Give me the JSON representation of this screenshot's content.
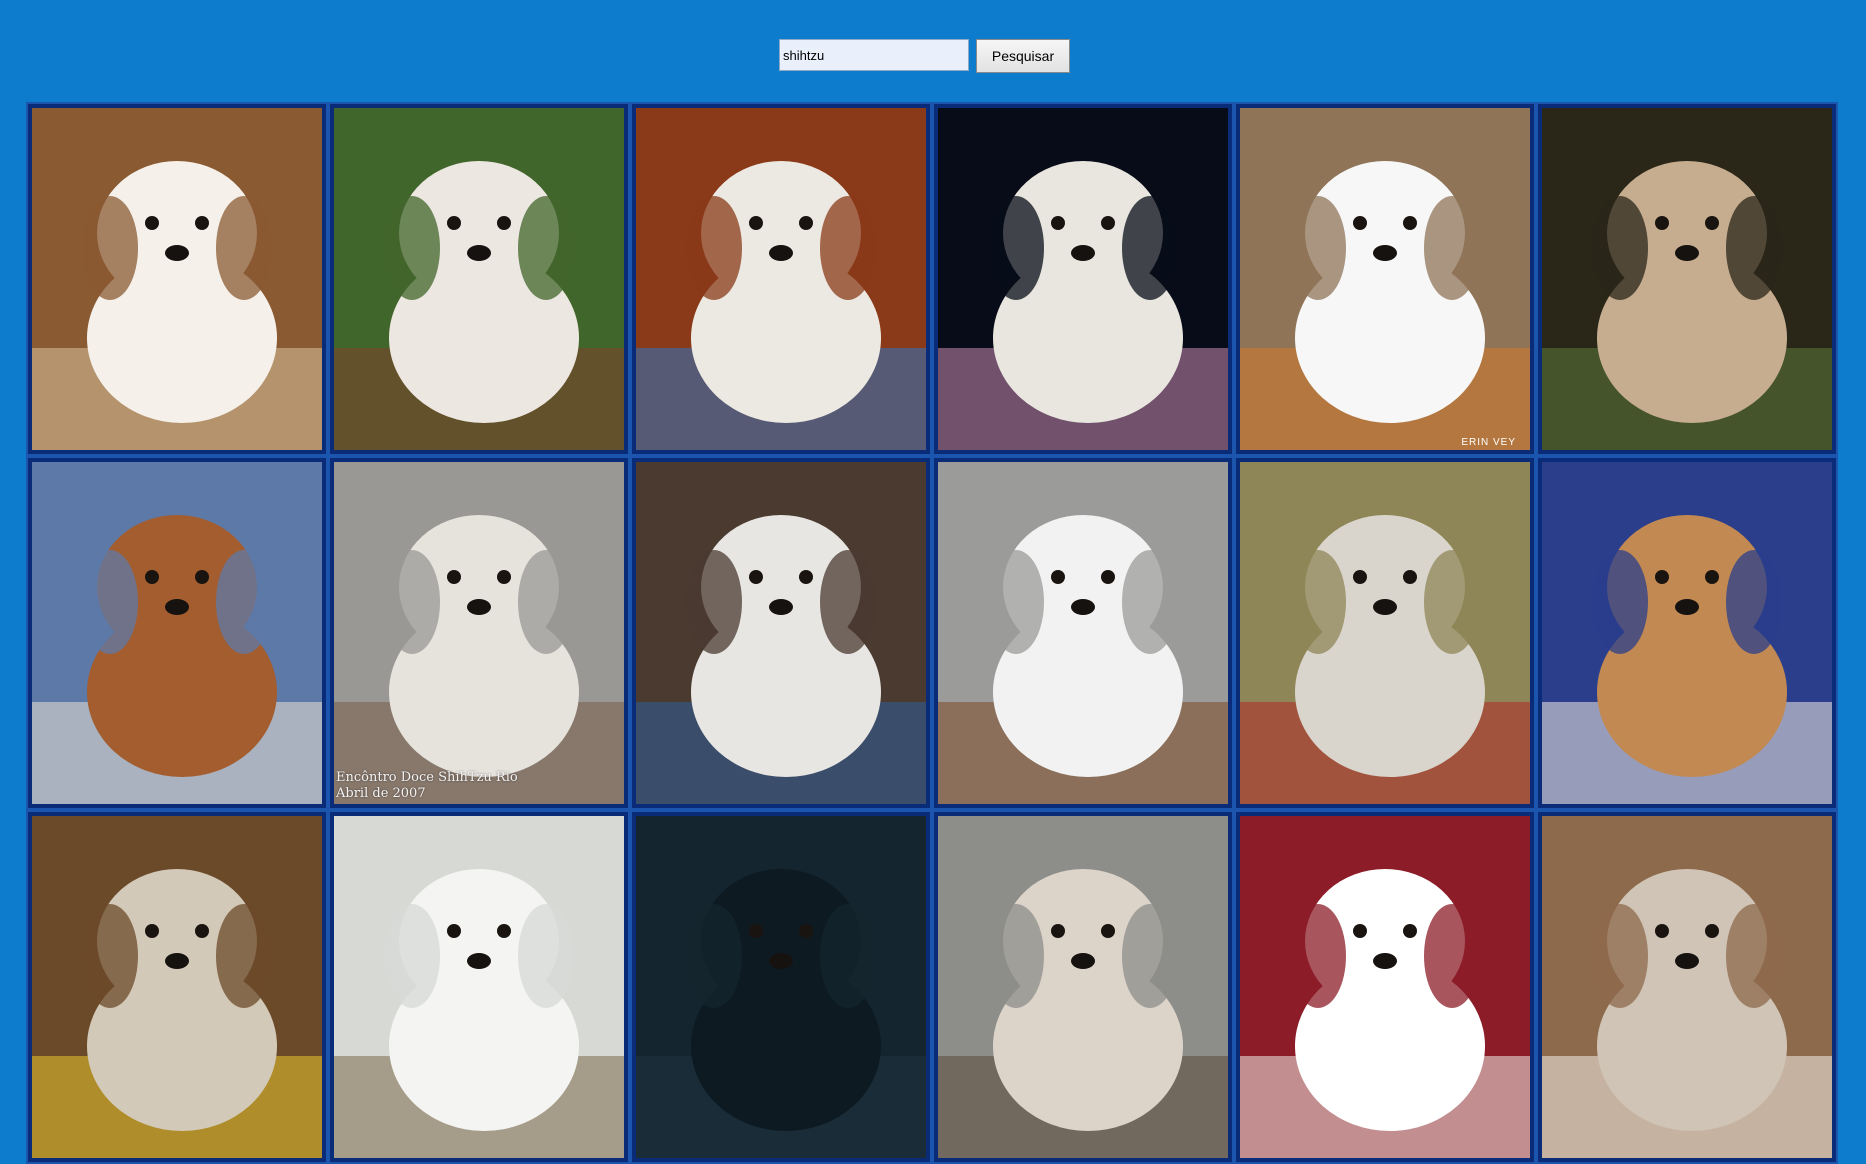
{
  "search": {
    "query": "shihtzu",
    "button_label": "Pesquisar"
  },
  "results": [
    {
      "colors": [
        "#f5f1ea",
        "#8a5a33",
        "#d8c39d"
      ],
      "caption": "",
      "watermark": ""
    },
    {
      "colors": [
        "#ece7e0",
        "#41662b",
        "#7f3f2c"
      ],
      "caption": "",
      "watermark": ""
    },
    {
      "colors": [
        "#ece9e2",
        "#8a3a18",
        "#2d74c2"
      ],
      "caption": "",
      "watermark": ""
    },
    {
      "colors": [
        "#e9e6e0",
        "#070c18",
        "#c98bb1"
      ],
      "caption": "",
      "watermark": ""
    },
    {
      "colors": [
        "#f7f7f7",
        "#8f7458",
        "#d27a2c"
      ],
      "caption": "",
      "watermark": "ERIN VEY"
    },
    {
      "colors": [
        "#c7ad8f",
        "#2a2618",
        "#5b7a3b"
      ],
      "caption": "",
      "watermark": ""
    },
    {
      "colors": [
        "#a35d2f",
        "#5d79a8",
        "#e8e2d0"
      ],
      "caption": "",
      "watermark": ""
    },
    {
      "colors": [
        "#e6e3dd",
        "#9a9894",
        "#7a5f4b"
      ],
      "caption": "Encôntro Doce ShihTzu Rio\nAbril de 2007",
      "watermark": ""
    },
    {
      "colors": [
        "#e8e6e2",
        "#4a3a30",
        "#2e5c9a"
      ],
      "caption": "",
      "watermark": ""
    },
    {
      "colors": [
        "#f2f2f2",
        "#9b9b99",
        "#7d4a26"
      ],
      "caption": "",
      "watermark": ""
    },
    {
      "colors": [
        "#d9d5cc",
        "#8f8657",
        "#b32a2a"
      ],
      "caption": "",
      "watermark": ""
    },
    {
      "colors": [
        "#c28a52",
        "#2a3e8c",
        "#eee9e0"
      ],
      "caption": "",
      "watermark": ""
    },
    {
      "colors": [
        "#d3c9b8",
        "#6b4a2a",
        "#e8c42a"
      ],
      "caption": "",
      "watermark": ""
    },
    {
      "colors": [
        "#f4f4f2",
        "#d7d9d5",
        "#7c6a4a"
      ],
      "caption": "",
      "watermark": ""
    },
    {
      "colors": [
        "#0d1a22",
        "#14252f",
        "#1e3340"
      ],
      "caption": "",
      "watermark": ""
    },
    {
      "colors": [
        "#dcd3c9",
        "#8d8d8a",
        "#5b4a3a"
      ],
      "caption": "",
      "watermark": ""
    },
    {
      "colors": [
        "#ffffff",
        "#8c1c28",
        "#f1ece6"
      ],
      "caption": "",
      "watermark": ""
    },
    {
      "colors": [
        "#cfc4b5",
        "#8e6a4c",
        "#f2ede6"
      ],
      "caption": "",
      "watermark": ""
    }
  ]
}
